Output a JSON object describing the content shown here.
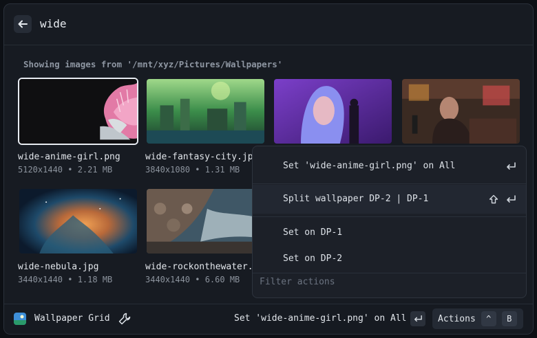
{
  "search": {
    "query": "wide"
  },
  "subtitle": "Showing images from '/mnt/xyz/Pictures/Wallpapers'",
  "wallpapers": [
    {
      "title": "wide-anime-girl.png",
      "meta": "5120x1440 • 2.21 MB",
      "selected": true
    },
    {
      "title": "wide-fantasy-city.jpg",
      "meta": "3840x1080 • 1.31 MB",
      "selected": false
    },
    {
      "title": "",
      "meta": "",
      "selected": false
    },
    {
      "title": "",
      "meta": "",
      "selected": false
    },
    {
      "title": "wide-nebula.jpg",
      "meta": "3440x1440 • 1.18 MB",
      "selected": false
    },
    {
      "title": "wide-rockonthewater.jpg",
      "meta": "3440x1440 • 6.60 MB",
      "selected": false
    }
  ],
  "menu": {
    "items": [
      {
        "label": "Set 'wide-anime-girl.png' on All",
        "keys": [
          "enter-icon"
        ]
      },
      {
        "label": "Split wallpaper DP-2 | DP-1",
        "keys": [
          "shift-icon",
          "enter-icon"
        ]
      },
      {
        "label": "Set on DP-1",
        "keys": []
      },
      {
        "label": "Set on DP-2",
        "keys": []
      }
    ],
    "filter_placeholder": "Filter actions"
  },
  "footer": {
    "app_name": "Wallpaper Grid",
    "primary_action": "Set 'wide-anime-girl.png' on All",
    "actions_label": "Actions",
    "actions_modifier": "^",
    "actions_key": "B"
  },
  "colors": {
    "background": "#171b22",
    "border": "#2b313b",
    "selected_border": "#e8ecf2",
    "text": "#e2e6eb",
    "muted_text": "#8c939d"
  }
}
